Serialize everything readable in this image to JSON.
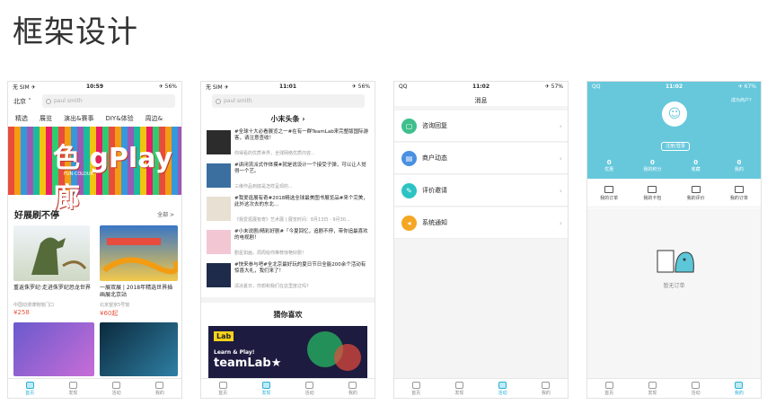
{
  "page_title": "框架设计",
  "tabs": [
    "首页",
    "发现",
    "活动",
    "我的"
  ],
  "phone1": {
    "status": {
      "left": "无 SIM ✈",
      "time": "10:59",
      "right": "✈ 56%"
    },
    "city": "北京 ˅",
    "search_placeholder": "paul smith",
    "nav": [
      "精选",
      "展览",
      "演出&赛事",
      "DIY&体验",
      "周边&"
    ],
    "banner_title": "色 gPlay 廊",
    "banner_sub": "FUN·COLOUR",
    "section_title": "好展刷不停",
    "section_more": "全部 >",
    "cards": [
      {
        "title": "重返侏罗纪·走进侏罗纪恐龙世界",
        "sub": "中国动漫博物馆门口",
        "price": "¥258"
      },
      {
        "title": "一展双展 | 2018年精选世界插画展北京站",
        "sub": "北京望京5号馆",
        "price": "¥60起"
      }
    ]
  },
  "phone2": {
    "status": {
      "left": "无 SIM ✈",
      "time": "11:01",
      "right": "✈ 56%"
    },
    "search_placeholder": "paul smith",
    "head": "小末头条 ›",
    "news": [
      {
        "title": "#全球十大必看展览之一#在有一群TeamLab来完整版国际游客，请注意查收！",
        "sub": "你得看的优质世界，全球网络优质内容..."
      },
      {
        "title": "#讲闭流派式作体摸#就是说设计一个接受子弹，可以让人觉得一个艺。",
        "sub": "三维作品到底是怎样呈现的..."
      },
      {
        "title": "#我爱逛展有奇#2018精选全球最美图书展览品#来个完美，此外这次去的东北...",
        "sub": "《我爱逛展有奇》艺术展 | 展览时间：8月13日 - 9月30..."
      },
      {
        "title": "#小末说剧/精彩好剧#「今夏回忆，追剧不停，带你追最喜欢的电视剧！",
        "sub": "剧星如画，周周给你推荐惊艳好剧！"
      },
      {
        "title": "#快来参与吧#全北京最好玩的夏日节日全能200余个活动有惊喜大礼，我们来了！",
        "sub": "清凉夏日，你想和我们在这里度过吗？"
      }
    ],
    "head2": "猜你喜欢",
    "lab_logo": "Lab",
    "lab_l1": "Learn & Play!",
    "lab_l2": "teamLab★"
  },
  "phone3": {
    "status": {
      "left": "QQ",
      "time": "11:02",
      "right": "✈ 57%"
    },
    "head": "消息",
    "items": [
      {
        "label": "咨询回复",
        "color": "#3fbf8c",
        "icon": "chat-icon"
      },
      {
        "label": "商户动态",
        "color": "#4a90e2",
        "icon": "store-icon"
      },
      {
        "label": "评价邀请",
        "color": "#2cc3c3",
        "icon": "star-icon"
      },
      {
        "label": "系统通知",
        "color": "#f5a623",
        "icon": "bell-icon"
      }
    ]
  },
  "phone4": {
    "status": {
      "left": "QQ",
      "time": "11:02",
      "right": "✈ 67%"
    },
    "top_link": "成为商户？",
    "login": "注册/登录",
    "stats": [
      {
        "num": "0",
        "label": "优惠"
      },
      {
        "num": "0",
        "label": "我的积分"
      },
      {
        "num": "0",
        "label": "收藏"
      },
      {
        "num": "0",
        "label": "我的"
      }
    ],
    "menu": [
      "我的订单",
      "我的卡包",
      "我的评价",
      "我的订单"
    ],
    "empty_text": "暂无订单"
  },
  "colors": {
    "accent": "#2ab0d6",
    "teal": "#67c8dc",
    "price": "#e8543f"
  }
}
